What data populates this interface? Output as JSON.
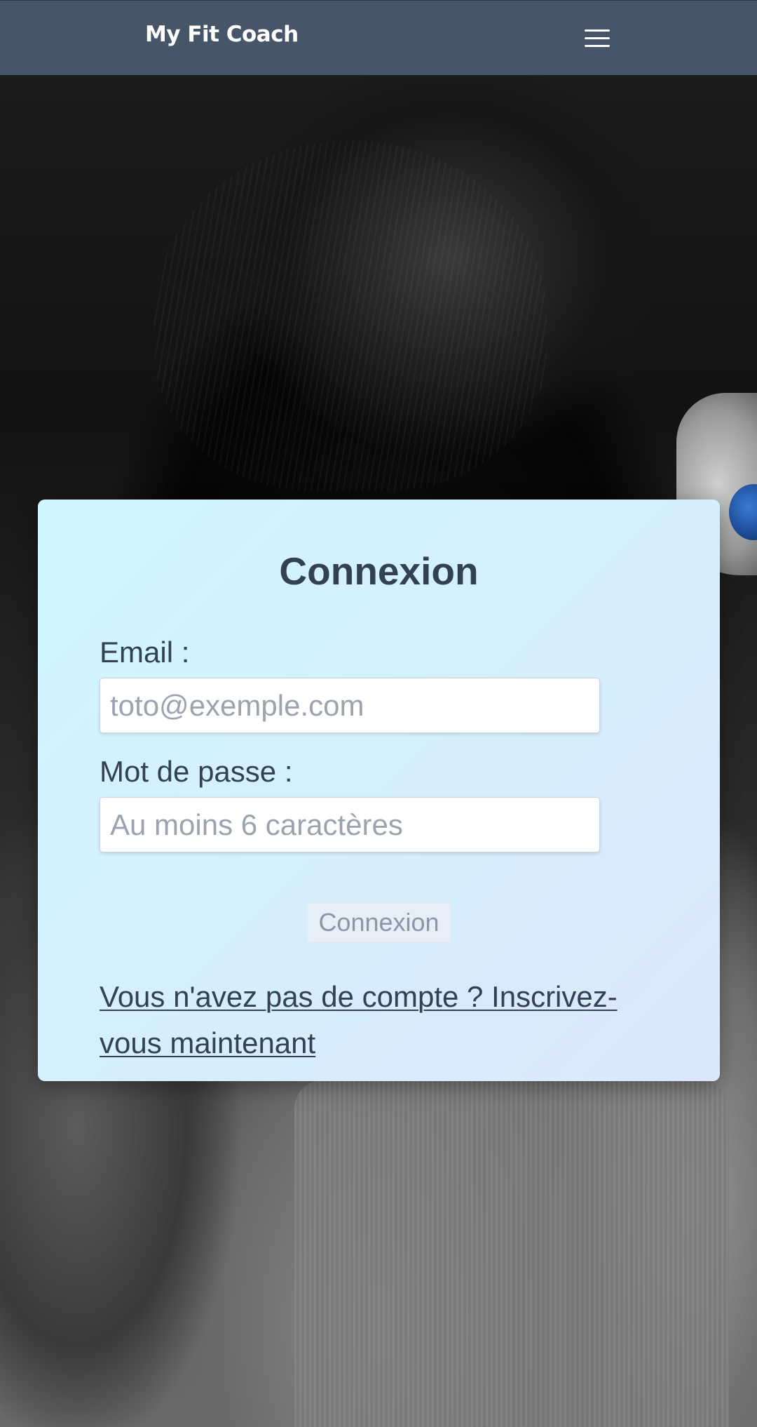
{
  "navbar": {
    "brand": "My Fit Coach",
    "menu_icon": "hamburger-menu-icon",
    "background_color": "#475569"
  },
  "background": {
    "description_icon": "athlete-background-photo"
  },
  "login_card": {
    "title": "Connexion",
    "email": {
      "label": "Email :",
      "value": "",
      "placeholder": "toto@exemple.com"
    },
    "password": {
      "label": "Mot de passe :",
      "value": "",
      "placeholder": "Au moins 6 caractères"
    },
    "submit_label": "Connexion",
    "signup_link": "Vous n'avez pas de compte ? Inscrivez-vous maintenant",
    "gradient_start": "#cff7fd",
    "gradient_end": "#dbe7fb"
  }
}
